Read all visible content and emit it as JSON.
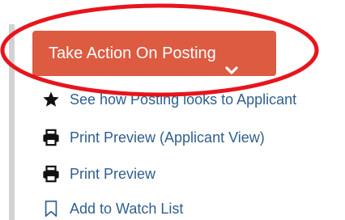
{
  "action_button": {
    "label": "Take Action On Posting",
    "color": "#dc5b41"
  },
  "annotation": {
    "ellipse_color": "#e8141c"
  },
  "menu": {
    "items": [
      {
        "label": "See how Posting looks to Applicant",
        "icon": "star-icon"
      },
      {
        "label": "Print Preview (Applicant View)",
        "icon": "printer-icon"
      },
      {
        "label": "Print Preview",
        "icon": "printer-icon"
      },
      {
        "label": "Add to Watch List",
        "icon": "bookmark-icon"
      }
    ],
    "link_color": "#2f5f8f"
  }
}
